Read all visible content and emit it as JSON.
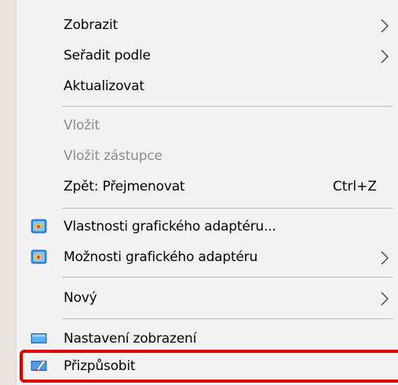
{
  "context_menu": {
    "items": [
      {
        "label": "Zobrazit"
      },
      {
        "label": "Seřadit podle"
      },
      {
        "label": "Aktualizovat"
      },
      {
        "label": "Vložit"
      },
      {
        "label": "Vložit zástupce"
      },
      {
        "label": "Zpět: Přejmenovat",
        "shortcut": "Ctrl+Z"
      },
      {
        "label": "Vlastnosti grafického adaptéru...",
        "icon": "graphics-adapter-icon"
      },
      {
        "label": "Možnosti grafického adaptéru",
        "icon": "graphics-adapter-icon"
      },
      {
        "label": "Nový"
      },
      {
        "label": "Nastavení zobrazení",
        "icon": "display-icon"
      },
      {
        "label": "Přizpůsobit",
        "icon": "personalize-icon"
      }
    ]
  },
  "highlight_color": "#e00000"
}
